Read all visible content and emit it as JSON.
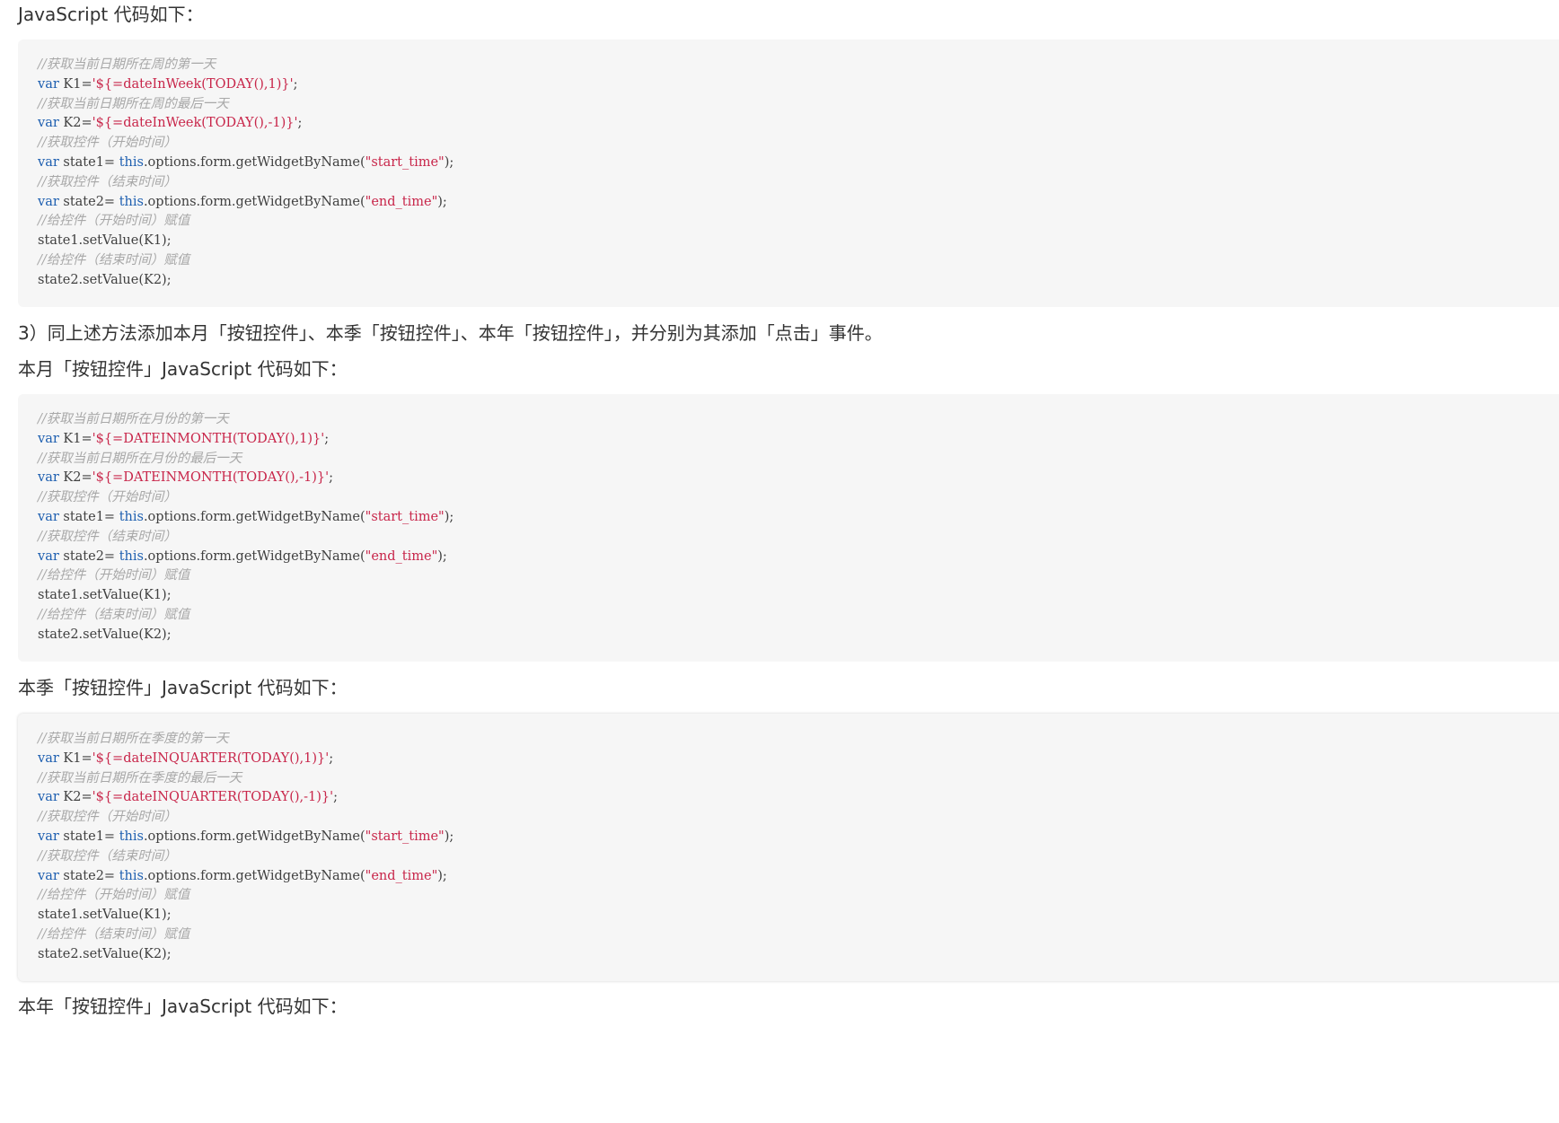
{
  "colors": {
    "page_background": "#ffffff",
    "body_text": "#333333",
    "code_background": "#f6f6f6",
    "code_text": "#404040",
    "comment": "#a8a8a8",
    "keyword": "#1e5fb0",
    "string": "#c8264a"
  },
  "paragraphs": {
    "intro_week": "JavaScript 代码如下：",
    "step3": "3）同上述方法添加本月「按钮控件」、本季「按钮控件」、本年「按钮控件」，并分别为其添加「点击」事件。",
    "month_heading": "本月「按钮控件」JavaScript 代码如下：",
    "quarter_heading": "本季「按钮控件」JavaScript 代码如下：",
    "year_heading": "本年「按钮控件」JavaScript 代码如下："
  },
  "code_blocks": [
    {
      "id": "week",
      "lines": [
        [
          {
            "t": "comment",
            "v": "//获取当前日期所在周的第一天"
          }
        ],
        [
          {
            "t": "kw",
            "v": "var"
          },
          {
            "t": "plain",
            "v": " K1="
          },
          {
            "t": "str",
            "v": "'${=dateInWeek(TODAY(),1)}'"
          },
          {
            "t": "plain",
            "v": ";"
          }
        ],
        [
          {
            "t": "comment",
            "v": "//获取当前日期所在周的最后一天"
          }
        ],
        [
          {
            "t": "kw",
            "v": "var"
          },
          {
            "t": "plain",
            "v": " K2="
          },
          {
            "t": "str",
            "v": "'${=dateInWeek(TODAY(),-1)}'"
          },
          {
            "t": "plain",
            "v": ";"
          }
        ],
        [
          {
            "t": "comment",
            "v": "//获取控件（开始时间）"
          }
        ],
        [
          {
            "t": "kw",
            "v": "var"
          },
          {
            "t": "plain",
            "v": " state1= "
          },
          {
            "t": "kw",
            "v": "this"
          },
          {
            "t": "plain",
            "v": ".options.form.getWidgetByName("
          },
          {
            "t": "str",
            "v": "\"start_time\""
          },
          {
            "t": "plain",
            "v": ");"
          }
        ],
        [
          {
            "t": "comment",
            "v": "//获取控件（结束时间）"
          }
        ],
        [
          {
            "t": "kw",
            "v": "var"
          },
          {
            "t": "plain",
            "v": " state2= "
          },
          {
            "t": "kw",
            "v": "this"
          },
          {
            "t": "plain",
            "v": ".options.form.getWidgetByName("
          },
          {
            "t": "str",
            "v": "\"end_time\""
          },
          {
            "t": "plain",
            "v": ");"
          }
        ],
        [
          {
            "t": "comment",
            "v": "//给控件（开始时间）赋值"
          }
        ],
        [
          {
            "t": "plain",
            "v": "state1.setValue(K1);"
          }
        ],
        [
          {
            "t": "comment",
            "v": "//给控件（结束时间）赋值"
          }
        ],
        [
          {
            "t": "plain",
            "v": "state2.setValue(K2);"
          }
        ]
      ]
    },
    {
      "id": "month",
      "lines": [
        [
          {
            "t": "comment",
            "v": "//获取当前日期所在月份的第一天"
          }
        ],
        [
          {
            "t": "kw",
            "v": "var"
          },
          {
            "t": "plain",
            "v": " K1="
          },
          {
            "t": "str",
            "v": "'${=DATEINMONTH(TODAY(),1)}'"
          },
          {
            "t": "plain",
            "v": ";"
          }
        ],
        [
          {
            "t": "comment",
            "v": "//获取当前日期所在月份的最后一天"
          }
        ],
        [
          {
            "t": "kw",
            "v": "var"
          },
          {
            "t": "plain",
            "v": " K2="
          },
          {
            "t": "str",
            "v": "'${=DATEINMONTH(TODAY(),-1)}'"
          },
          {
            "t": "plain",
            "v": ";"
          }
        ],
        [
          {
            "t": "comment",
            "v": "//获取控件（开始时间）"
          }
        ],
        [
          {
            "t": "kw",
            "v": "var"
          },
          {
            "t": "plain",
            "v": " state1= "
          },
          {
            "t": "kw",
            "v": "this"
          },
          {
            "t": "plain",
            "v": ".options.form.getWidgetByName("
          },
          {
            "t": "str",
            "v": "\"start_time\""
          },
          {
            "t": "plain",
            "v": ");"
          }
        ],
        [
          {
            "t": "comment",
            "v": "//获取控件（结束时间）"
          }
        ],
        [
          {
            "t": "kw",
            "v": "var"
          },
          {
            "t": "plain",
            "v": " state2= "
          },
          {
            "t": "kw",
            "v": "this"
          },
          {
            "t": "plain",
            "v": ".options.form.getWidgetByName("
          },
          {
            "t": "str",
            "v": "\"end_time\""
          },
          {
            "t": "plain",
            "v": ");"
          }
        ],
        [
          {
            "t": "comment",
            "v": "//给控件（开始时间）赋值"
          }
        ],
        [
          {
            "t": "plain",
            "v": "state1.setValue(K1);"
          }
        ],
        [
          {
            "t": "comment",
            "v": "//给控件（结束时间）赋值"
          }
        ],
        [
          {
            "t": "plain",
            "v": "state2.setValue(K2);"
          }
        ]
      ]
    },
    {
      "id": "quarter",
      "lines": [
        [
          {
            "t": "comment",
            "v": "//获取当前日期所在季度的第一天"
          }
        ],
        [
          {
            "t": "kw",
            "v": "var"
          },
          {
            "t": "plain",
            "v": " K1="
          },
          {
            "t": "str",
            "v": "'${=dateINQUARTER(TODAY(),1)}'"
          },
          {
            "t": "plain",
            "v": ";"
          }
        ],
        [
          {
            "t": "comment",
            "v": "//获取当前日期所在季度的最后一天"
          }
        ],
        [
          {
            "t": "kw",
            "v": "var"
          },
          {
            "t": "plain",
            "v": " K2="
          },
          {
            "t": "str",
            "v": "'${=dateINQUARTER(TODAY(),-1)}'"
          },
          {
            "t": "plain",
            "v": ";"
          }
        ],
        [
          {
            "t": "comment",
            "v": "//获取控件（开始时间）"
          }
        ],
        [
          {
            "t": "kw",
            "v": "var"
          },
          {
            "t": "plain",
            "v": " state1= "
          },
          {
            "t": "kw",
            "v": "this"
          },
          {
            "t": "plain",
            "v": ".options.form.getWidgetByName("
          },
          {
            "t": "str",
            "v": "\"start_time\""
          },
          {
            "t": "plain",
            "v": ");"
          }
        ],
        [
          {
            "t": "comment",
            "v": "//获取控件（结束时间）"
          }
        ],
        [
          {
            "t": "kw",
            "v": "var"
          },
          {
            "t": "plain",
            "v": " state2= "
          },
          {
            "t": "kw",
            "v": "this"
          },
          {
            "t": "plain",
            "v": ".options.form.getWidgetByName("
          },
          {
            "t": "str",
            "v": "\"end_time\""
          },
          {
            "t": "plain",
            "v": ");"
          }
        ],
        [
          {
            "t": "comment",
            "v": "//给控件（开始时间）赋值"
          }
        ],
        [
          {
            "t": "plain",
            "v": "state1.setValue(K1);"
          }
        ],
        [
          {
            "t": "comment",
            "v": "//给控件（结束时间）赋值"
          }
        ],
        [
          {
            "t": "plain",
            "v": "state2.setValue(K2);"
          }
        ]
      ]
    }
  ]
}
